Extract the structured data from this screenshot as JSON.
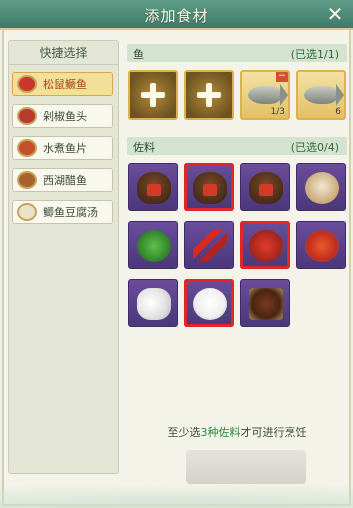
{
  "window": {
    "title": "添加食材",
    "close_icon": "close-icon"
  },
  "quick_select": {
    "title": "快捷选择",
    "dishes": [
      {
        "label": "松鼠鳜鱼",
        "active": true
      },
      {
        "label": "剁椒鱼头",
        "active": false
      },
      {
        "label": "水煮鱼片",
        "active": false
      },
      {
        "label": "西湖醋鱼",
        "active": false
      },
      {
        "label": "鲫鱼豆腐汤",
        "active": false
      }
    ]
  },
  "fish": {
    "name": "鱼",
    "count_label": "(已选1/1)",
    "slots": [
      {
        "type": "empty",
        "icon": "plus-icon"
      },
      {
        "type": "empty",
        "icon": "plus-icon"
      },
      {
        "type": "fish",
        "count": "1/3",
        "removable": true
      },
      {
        "type": "fish",
        "count": "6",
        "removable": false
      }
    ]
  },
  "seasoning": {
    "name": "佐料",
    "count_label": "(已选0/4)",
    "items": [
      {
        "kind": "jar",
        "selected": false
      },
      {
        "kind": "jar",
        "selected": true
      },
      {
        "kind": "jar",
        "selected": false
      },
      {
        "kind": "flour",
        "selected": false
      },
      {
        "kind": "greens",
        "selected": false
      },
      {
        "kind": "peppers",
        "selected": false
      },
      {
        "kind": "sauce",
        "selected": true
      },
      {
        "kind": "chili-bowl",
        "selected": false
      },
      {
        "kind": "eggs",
        "selected": false
      },
      {
        "kind": "sugar",
        "selected": true
      },
      {
        "kind": "beans",
        "selected": false
      }
    ]
  },
  "hint": {
    "prefix": "至少选",
    "emphasis": "3种佐料",
    "suffix": "才可进行烹饪"
  },
  "colors": {
    "header": "#4f8c78",
    "active_dish": "#f2df9a",
    "selected_outline": "#e3242b",
    "emphasis": "#2b8a3f"
  }
}
